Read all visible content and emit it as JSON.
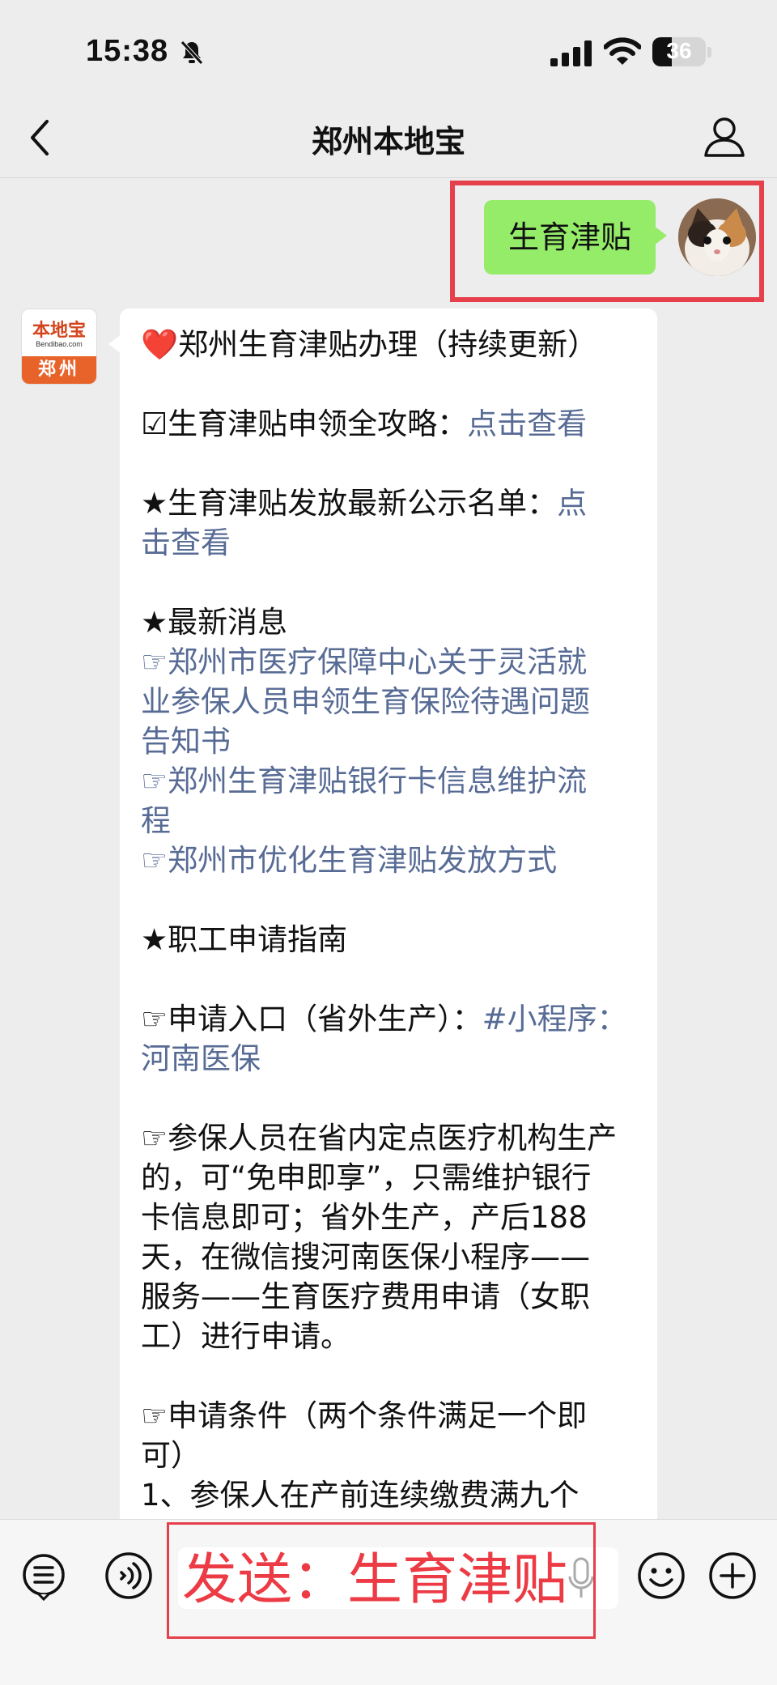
{
  "status_bar": {
    "time": "15:38",
    "battery": "36",
    "battery_level": 0.36
  },
  "nav": {
    "title": "郑州本地宝"
  },
  "chat": {
    "outgoing_text": "生育津贴",
    "bot_logo": {
      "name": "本地宝",
      "domain": "Bendibao.com",
      "city": "郑州"
    },
    "message": {
      "title": "郑州生育津贴办理（持续更新）",
      "guide_label": "☑生育津贴申领全攻略：",
      "guide_link": "点击查看",
      "list_label": "★生育津贴发放最新公示名单：",
      "list_link_1": "点",
      "list_link_2": "击查看",
      "news_heading": "★最新消息",
      "news_1_line1": "☞郑州市医疗保障中心关于灵活就",
      "news_1_line2": "业参保人员申领生育保险待遇问题",
      "news_1_line3": "告知书",
      "news_2_line1": "☞郑州生育津贴银行卡信息维护流",
      "news_2_line2": "程",
      "news_3": "☞郑州市优化生育津贴发放方式",
      "staff_heading": "★职工申请指南",
      "entry_label": "☞申请入口（省外生产）：",
      "entry_link_1": "#小程序：",
      "entry_link_2": "河南医保",
      "para_1": "☞参保人员在省内定点医疗机构生产",
      "para_2": "的，可“免申即享”，只需维护银行",
      "para_3": "卡信息即可；省外生产，产后188",
      "para_4": "天，在微信搜河南医保小程序——",
      "para_5": "服务——生育医疗费用申请（女职",
      "para_6": "工）进行申请。",
      "cond_1": "☞申请条件（两个条件满足一个即",
      "cond_2": "可）",
      "cond_3": "1、参保人在产前连续缴费满九个"
    }
  },
  "input": {
    "annotation": "发送：生育津贴"
  },
  "colors": {
    "accent_red": "#e5404b",
    "bubble_green": "#95ec69",
    "link_blue": "#576b95"
  }
}
